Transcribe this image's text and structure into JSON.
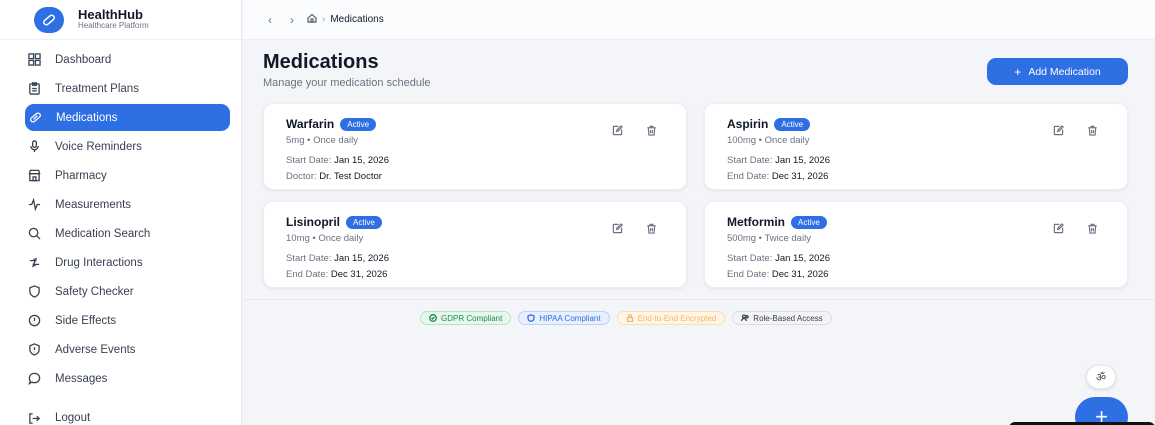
{
  "brand": {
    "title": "HealthHub",
    "subtitle": "Healthcare Platform"
  },
  "sidebar": {
    "items": [
      {
        "label": "Dashboard",
        "icon": "grid-icon"
      },
      {
        "label": "Treatment Plans",
        "icon": "clipboard-icon"
      },
      {
        "label": "Medications",
        "icon": "pill-icon",
        "active": true
      },
      {
        "label": "Voice Reminders",
        "icon": "microphone-icon"
      },
      {
        "label": "Pharmacy",
        "icon": "store-icon"
      },
      {
        "label": "Measurements",
        "icon": "activity-icon"
      },
      {
        "label": "Medication Search",
        "icon": "search-icon"
      },
      {
        "label": "Drug Interactions",
        "icon": "interaction-icon"
      },
      {
        "label": "Safety Checker",
        "icon": "shield-icon"
      },
      {
        "label": "Side Effects",
        "icon": "alert-circle-icon"
      },
      {
        "label": "Adverse Events",
        "icon": "alert-shield-icon"
      },
      {
        "label": "Messages",
        "icon": "message-icon"
      }
    ],
    "logout": "Logout"
  },
  "breadcrumb": {
    "current": "Medications"
  },
  "page": {
    "title": "Medications",
    "subtitle": "Manage your medication schedule",
    "add_button": "Add Medication"
  },
  "medications": [
    {
      "name": "Warfarin",
      "status": "Active",
      "dose": "5mg • Once daily",
      "line1_label": "Start Date:",
      "line1_value": "Jan 15, 2026",
      "line2_label": "Doctor:",
      "line2_value": "Dr. Test Doctor"
    },
    {
      "name": "Aspirin",
      "status": "Active",
      "dose": "100mg • Once daily",
      "line1_label": "Start Date:",
      "line1_value": "Jan 15, 2026",
      "line2_label": "End Date:",
      "line2_value": "Dec 31, 2026"
    },
    {
      "name": "Lisinopril",
      "status": "Active",
      "dose": "10mg • Once daily",
      "line1_label": "Start Date:",
      "line1_value": "Jan 15, 2026",
      "line2_label": "End Date:",
      "line2_value": "Dec 31, 2026"
    },
    {
      "name": "Metformin",
      "status": "Active",
      "dose": "500mg • Twice daily",
      "line1_label": "Start Date:",
      "line1_value": "Jan 15, 2026",
      "line2_label": "End Date:",
      "line2_value": "Dec 31, 2026"
    }
  ],
  "compliance": {
    "gdpr": "GDPR Compliant",
    "hipaa": "HIPAA Compliant",
    "e2e": "End-to-End Encrypted",
    "rba": "Role-Based Access"
  },
  "fab_small_label": "ॐ",
  "colors": {
    "accent": "#2f6fe4",
    "gdpr": "#1c8c4c",
    "e2e": "#f2b763"
  }
}
